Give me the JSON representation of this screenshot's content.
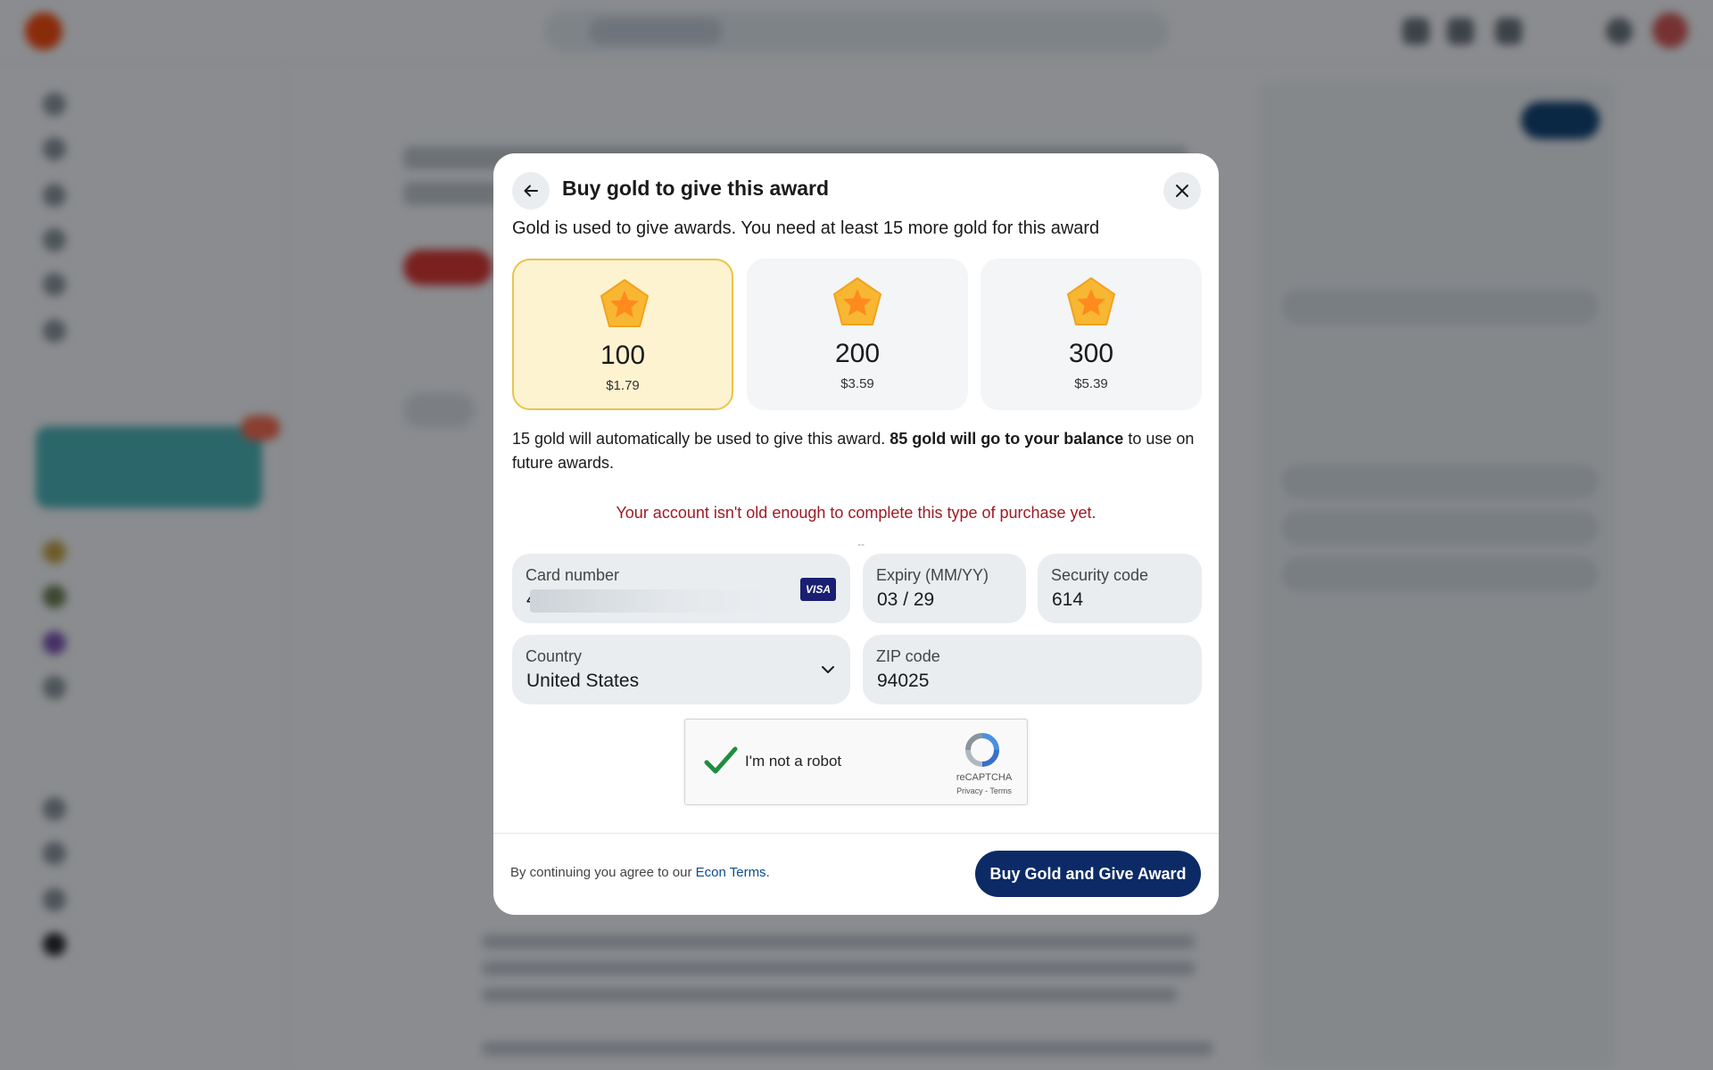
{
  "modal": {
    "title": "Buy gold to give this award",
    "intro": "Gold is used to give awards. You need at least 15 more gold for this award",
    "packages": [
      {
        "amount": "100",
        "price": "$1.79",
        "selected": true
      },
      {
        "amount": "200",
        "price": "$3.59",
        "selected": false
      },
      {
        "amount": "300",
        "price": "$5.39",
        "selected": false
      }
    ],
    "note_part1": "15 gold will automatically be used to give this award.",
    "note_bold": "85 gold will go to your balance",
    "note_part2": "to use on future awards.",
    "error": "Your account isn't old enough to complete this type of purchase yet.",
    "form": {
      "card_label": "Card number",
      "card_value_prefix": "4",
      "card_brand": "VISA",
      "expiry_label": "Expiry (MM/YY)",
      "expiry_value": "03 / 29",
      "cvv_label": "Security code",
      "cvv_value": "614",
      "country_label": "Country",
      "country_value": "United States",
      "zip_label": "ZIP code",
      "zip_value": "94025"
    },
    "captcha": {
      "label": "I'm not a robot",
      "brand": "reCAPTCHA",
      "links": "Privacy - Terms"
    },
    "footer": {
      "terms_prefix": "By continuing you agree to our",
      "terms_link": "Econ Terms",
      "terms_suffix": ".",
      "buy_label": "Buy Gold and Give Award"
    }
  },
  "colors": {
    "primary_button": "#0c2b66",
    "selected_package_bg": "#fdf3d0",
    "selected_package_border": "#e9c44d",
    "error_text": "#9e1b23",
    "field_bg": "#e9edf0",
    "overlay": "rgba(10,14,20,0.48)"
  },
  "icons": [
    "back-arrow-icon",
    "close-icon",
    "gold-star-icon",
    "visa-icon",
    "chevron-down-icon",
    "checkmark-icon",
    "recaptcha-icon"
  ]
}
